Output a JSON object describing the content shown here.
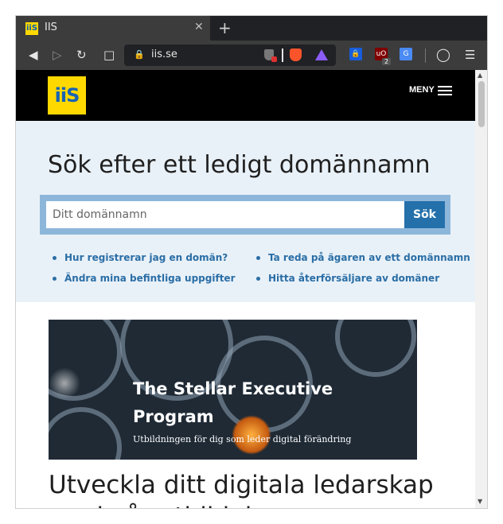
{
  "browser": {
    "tab_title": "IIS",
    "favicon_text": "iiS",
    "url": "iis.se",
    "extension_badge": "2",
    "icons": [
      "back-icon",
      "forward-icon",
      "reload-icon",
      "bookmark-icon",
      "lock-icon",
      "brave-shield-icon",
      "brave-rewards-icon",
      "bitwarden-icon",
      "ublock-icon",
      "translate-icon",
      "profile-icon",
      "menu-icon"
    ]
  },
  "site": {
    "logo_text": "iiS",
    "menu_label": "MENY",
    "brand_color": "#ffd800",
    "link_color": "#2a6ea6"
  },
  "hero": {
    "title": "Sök efter ett ledigt domännamn",
    "search_placeholder": "Ditt domännamn",
    "search_button": "Sök",
    "links": [
      "Hur registrerar jag en domän?",
      "Ta reda på ägaren av ett domännamn",
      "Ändra mina befintliga uppgifter",
      "Hitta återförsäljare av domäner"
    ]
  },
  "banner": {
    "title": "The Stellar Executive Program",
    "subtitle": "Utbildningen för dig som leder digital förändring"
  },
  "article": {
    "headline": "Utveckla ditt digitala ledarskap med vår utbildning"
  }
}
